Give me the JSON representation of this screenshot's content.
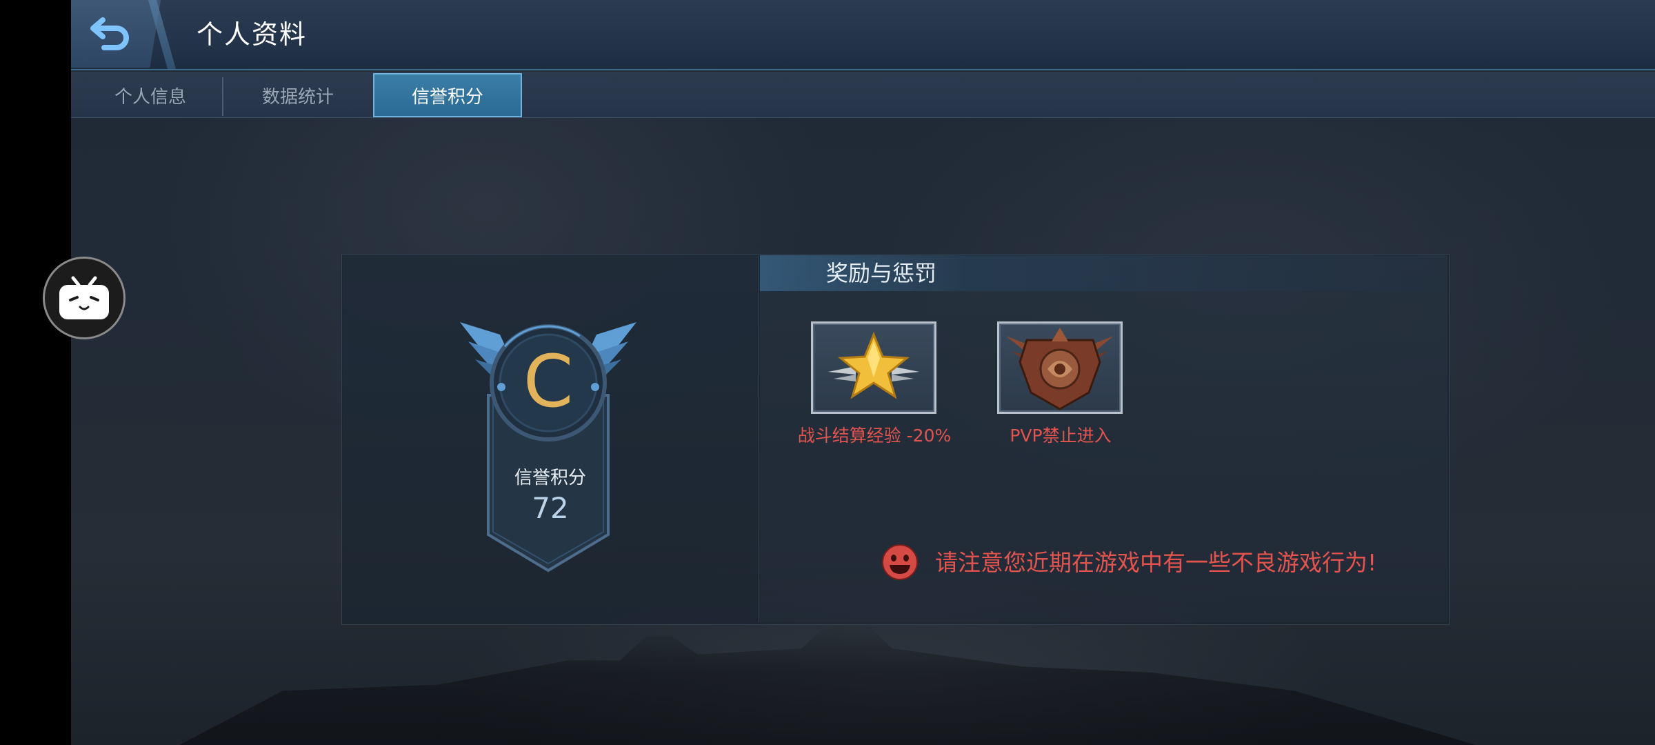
{
  "header": {
    "back_icon": "back-arrow-icon",
    "title": "个人资料"
  },
  "tabs": [
    {
      "label": "个人信息",
      "active": false
    },
    {
      "label": "数据统计",
      "active": false
    },
    {
      "label": "信誉积分",
      "active": true
    }
  ],
  "credit": {
    "grade": "C",
    "label": "信誉积分",
    "value": "72"
  },
  "rewards_penalties": {
    "title": "奖励与惩罚",
    "items": [
      {
        "icon": "gold-star-icon",
        "label": "战斗结算经验 -20%"
      },
      {
        "icon": "bronze-crest-icon",
        "label": "PVP禁止进入"
      }
    ]
  },
  "warning": {
    "icon": "red-face-icon",
    "text": "请注意您近期在游戏中有一些不良游戏行为!"
  },
  "floating_button": {
    "icon": "bilibili-tv-icon"
  },
  "colors": {
    "accent": "#3b7ea8",
    "penalty_red": "#e3544f",
    "grade_gold": "#e2b35a"
  }
}
